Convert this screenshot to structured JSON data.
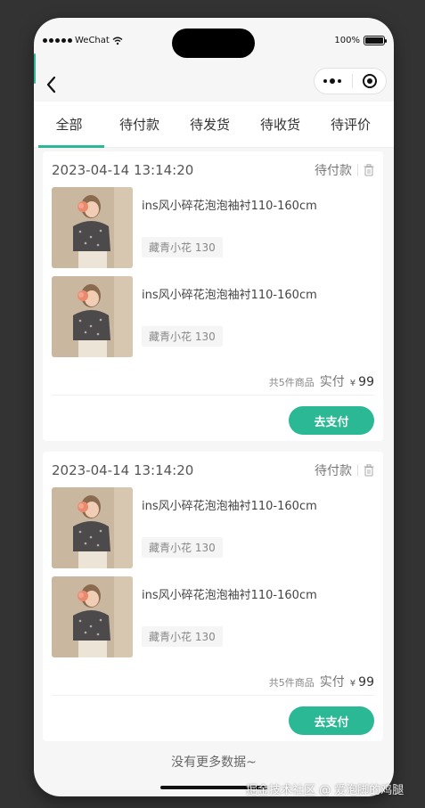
{
  "status_bar": {
    "carrier": "WeChat",
    "battery": "100%"
  },
  "capsule": {
    "more_icon": "more-dots-icon",
    "close_icon": "target-icon"
  },
  "tabs": [
    {
      "label": "全部",
      "active": true
    },
    {
      "label": "待付款",
      "active": false
    },
    {
      "label": "待发货",
      "active": false
    },
    {
      "label": "待收货",
      "active": false
    },
    {
      "label": "待评价",
      "active": false
    }
  ],
  "orders": [
    {
      "time": "2023-04-14 13:14:20",
      "status": "待付款",
      "items": [
        {
          "name": "ins风小碎花泡泡袖衬110-160cm",
          "sku": "藏青小花 130"
        },
        {
          "name": "ins风小碎花泡泡袖衬110-160cm",
          "sku": "藏青小花 130"
        }
      ],
      "count_label": "共5件商品",
      "paid_label": "实付",
      "currency": "¥",
      "amount": "99",
      "pay_button": "去支付"
    },
    {
      "time": "2023-04-14 13:14:20",
      "status": "待付款",
      "items": [
        {
          "name": "ins风小碎花泡泡袖衬110-160cm",
          "sku": "藏青小花 130"
        },
        {
          "name": "ins风小碎花泡泡袖衬110-160cm",
          "sku": "藏青小花 130"
        }
      ],
      "count_label": "共5件商品",
      "paid_label": "实付",
      "currency": "¥",
      "amount": "99",
      "pay_button": "去支付"
    }
  ],
  "no_more": "没有更多数据~",
  "watermark": "掘金技术社区 @ 爱泡脚的鸡腿",
  "colors": {
    "accent": "#2bb894",
    "background": "#333333",
    "page": "#f6f6f6"
  }
}
